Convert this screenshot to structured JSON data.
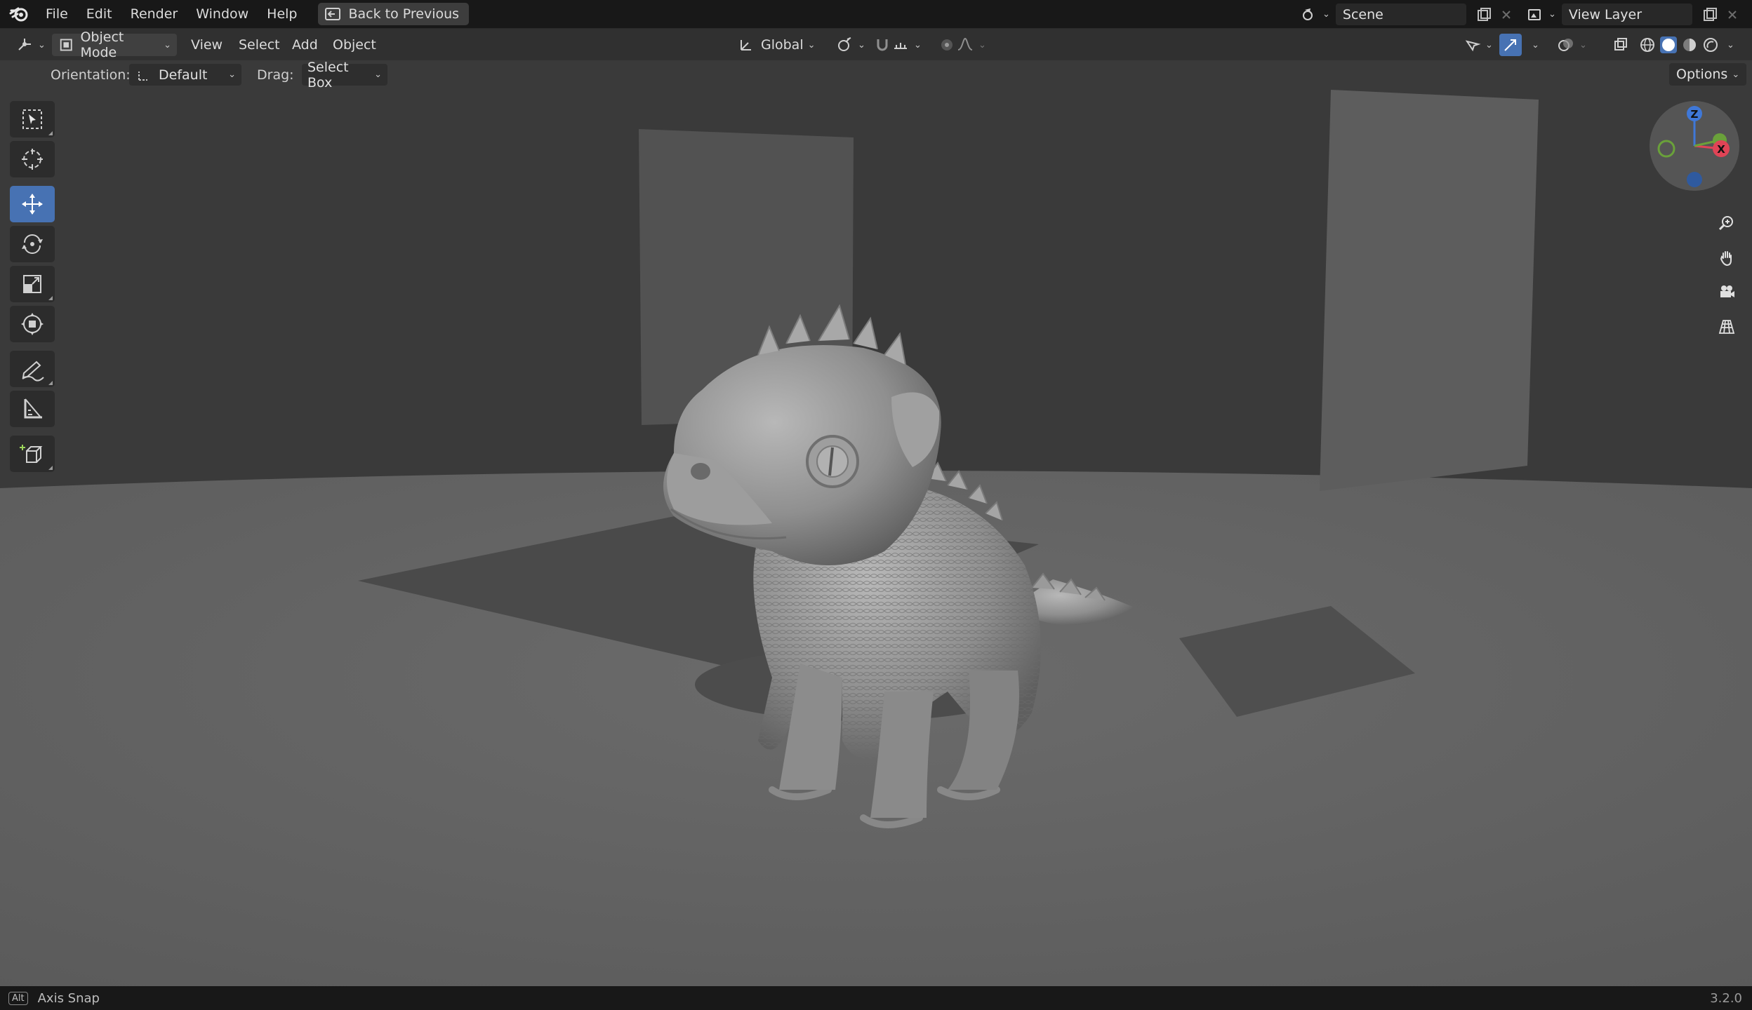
{
  "menu": {
    "items": [
      "File",
      "Edit",
      "Render",
      "Window",
      "Help"
    ],
    "back_button": "Back to Previous"
  },
  "scene": {
    "label": "Scene"
  },
  "view_layer": {
    "label": "View Layer"
  },
  "header": {
    "mode": "Object Mode",
    "menus": [
      "View",
      "Select",
      "Add",
      "Object"
    ],
    "transform_orientation": "Global"
  },
  "tool_settings": {
    "orientation_label": "Orientation:",
    "orientation_value": "Default",
    "drag_label": "Drag:",
    "drag_value": "Select Box",
    "options_label": "Options"
  },
  "toolbar": {
    "tools": [
      {
        "name": "select-box",
        "active": false
      },
      {
        "name": "cursor",
        "active": false
      },
      {
        "name": "move",
        "active": true
      },
      {
        "name": "rotate",
        "active": false
      },
      {
        "name": "scale",
        "active": false
      },
      {
        "name": "transform",
        "active": false
      },
      {
        "name": "annotate",
        "active": false
      },
      {
        "name": "measure",
        "active": false
      },
      {
        "name": "add-cube",
        "active": false
      }
    ]
  },
  "gizmo": {
    "x_label": "X",
    "z_label": "Z"
  },
  "status": {
    "key": "Alt",
    "text": "Axis Snap",
    "version": "3.2.0"
  },
  "colors": {
    "accent": "#4772b3",
    "axis_x": "#e04456",
    "axis_y": "#6aa13a",
    "axis_z": "#3f78d8"
  }
}
